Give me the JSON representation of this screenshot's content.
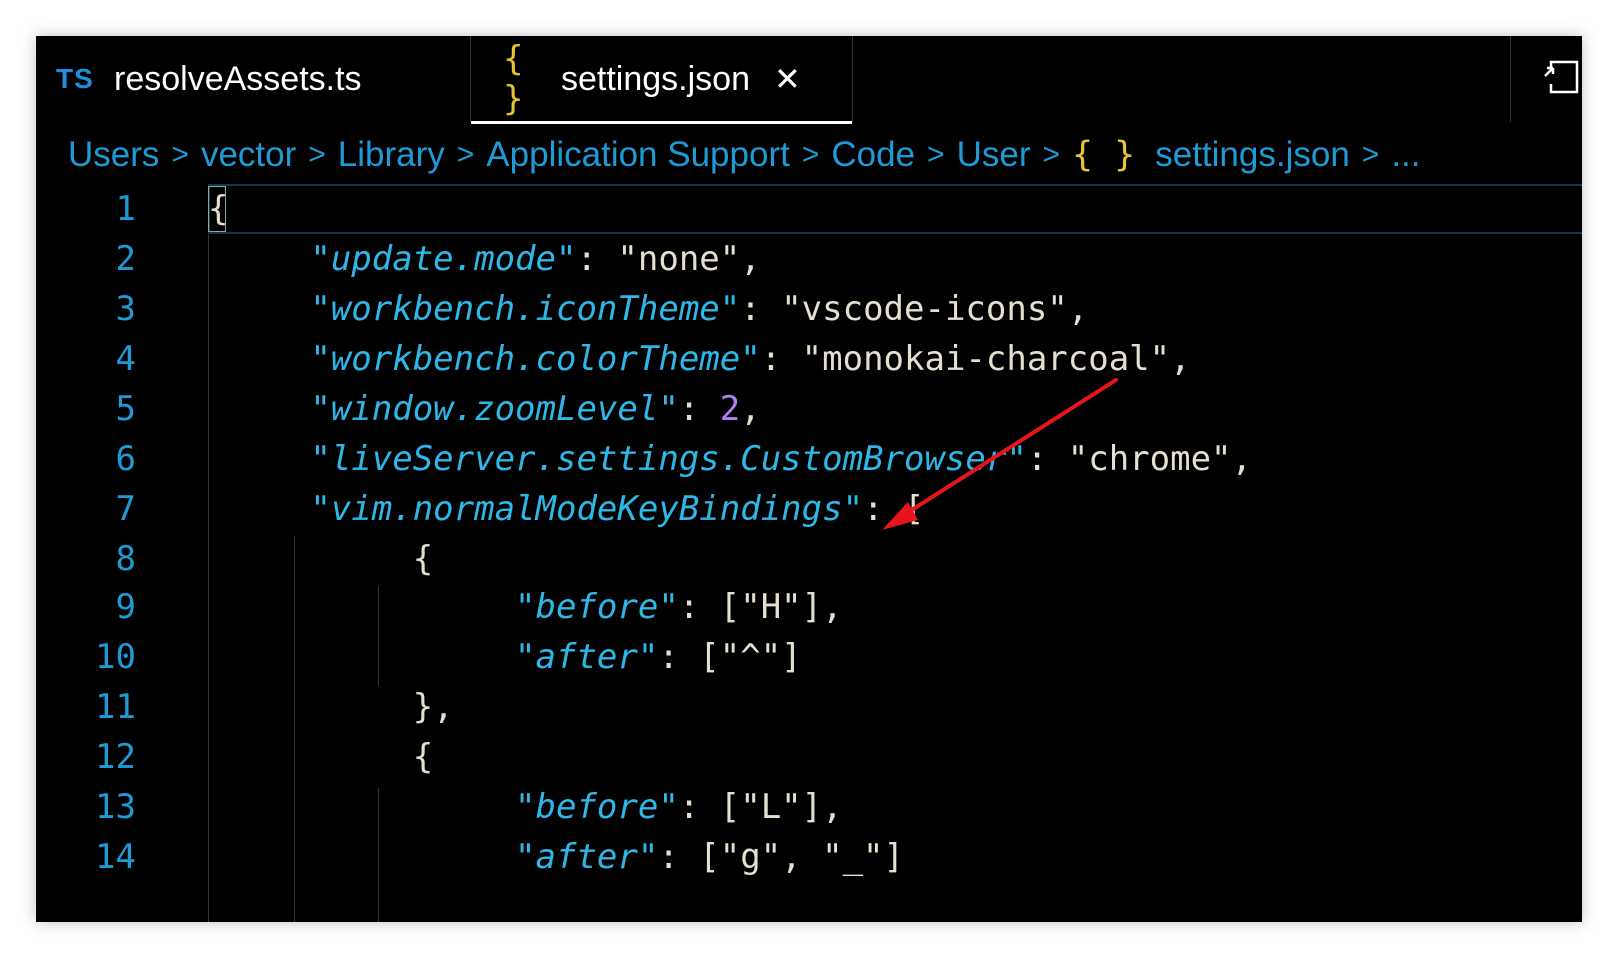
{
  "tabs": [
    {
      "icon": "TS",
      "label": "resolveAssets.ts",
      "active": false
    },
    {
      "icon": "{ }",
      "label": "settings.json",
      "active": true,
      "close": "✕"
    }
  ],
  "breadcrumb": {
    "items": [
      "Users",
      "vector",
      "Library",
      "Application Support",
      "Code",
      "User"
    ],
    "file_icon": "{ }",
    "file": "settings.json",
    "more": "...",
    "separator": ">"
  },
  "editor": {
    "line_numbers": [
      "1",
      "2",
      "3",
      "4",
      "5",
      "6",
      "7",
      "8",
      "9",
      "10",
      "11",
      "12",
      "13",
      "14"
    ],
    "lines": {
      "l1": {
        "p": "{"
      },
      "l2": {
        "k": "\"update.mode\"",
        "p": ": ",
        "s": "\"none\"",
        "t": ","
      },
      "l3": {
        "k": "\"workbench.iconTheme\"",
        "p": ": ",
        "s": "\"vscode-icons\"",
        "t": ","
      },
      "l4": {
        "k": "\"workbench.colorTheme\"",
        "p": ": ",
        "s": "\"monokai-charcoal\"",
        "t": ","
      },
      "l5": {
        "k": "\"window.zoomLevel\"",
        "p": ": ",
        "n": "2",
        "t": ","
      },
      "l6": {
        "k": "\"liveServer.settings.CustomBrowser\"",
        "p": ": ",
        "s": "\"chrome\"",
        "t": ","
      },
      "l7": {
        "k": "\"vim.normalModeKeyBindings\"",
        "p": ": ",
        "t": "["
      },
      "l8": {
        "p": "{"
      },
      "l9": {
        "k": "\"before\"",
        "p": ": ",
        "s": "[\"H\"]",
        "t": ","
      },
      "l10": {
        "k": "\"after\"",
        "p": ": ",
        "s": "[\"^\"]"
      },
      "l11": {
        "p": "},"
      },
      "l12": {
        "p": "{"
      },
      "l13": {
        "k": "\"before\"",
        "p": ": ",
        "s": "[\"L\"]",
        "t": ","
      },
      "l14": {
        "k": "\"after\"",
        "p": ": ",
        "s": "[\"g\", \"_\"]"
      }
    }
  },
  "colors": {
    "keys": "#2fb7e8",
    "strings": "#e4dfcf",
    "numbers": "#b27ef7",
    "line_numbers": "#1e9bd7",
    "json_icon": "#e8c42e",
    "annotation_arrow": "#e8141b"
  }
}
